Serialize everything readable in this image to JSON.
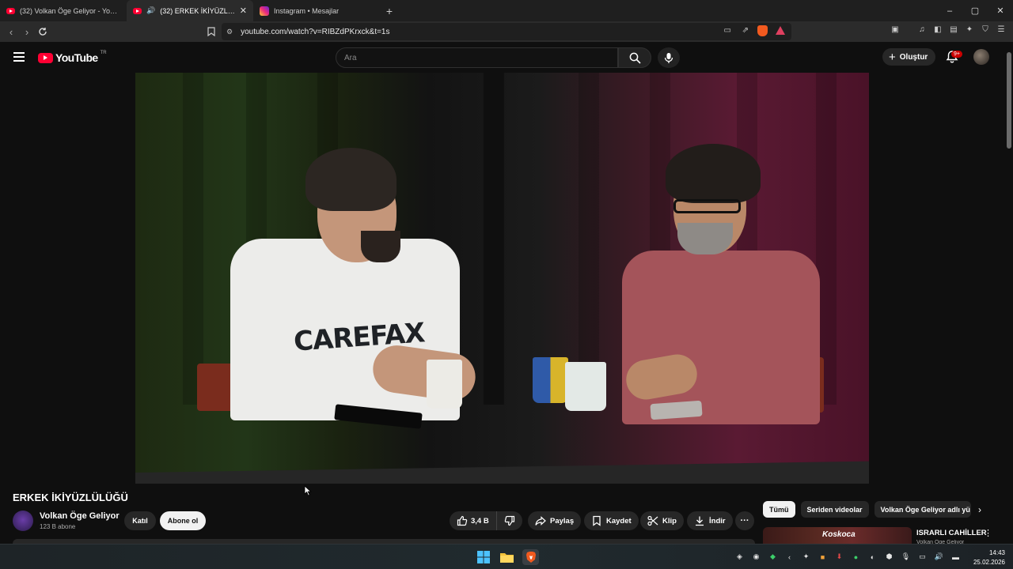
{
  "browser": {
    "tabs": [
      {
        "title": "(32) Volkan Öge Geliyor - YouTube",
        "active": false
      },
      {
        "title": "(32) ERKEK İKİYÜZLÜLÜĞÜ - Y",
        "active": true
      },
      {
        "title": "Instagram • Mesajlar",
        "active": false
      }
    ],
    "new_tab": "+",
    "window_controls": {
      "minimize": "–",
      "restore": "▢",
      "close": "✕"
    },
    "url": "youtube.com/watch?v=RIBZdPKrxck&t=1s"
  },
  "youtube": {
    "logo_text": "YouTube",
    "country_code": "TR",
    "search_placeholder": "Ara",
    "create_label": "Oluştur",
    "notification_badge": "9+"
  },
  "video": {
    "title": "ERKEK İKİYÜZLÜLÜĞÜ",
    "shirt_text": "CAREFAX",
    "channel_name": "Volkan Öge Geliyor",
    "subscribers": "123 B abone",
    "join_label": "Katıl",
    "subscribe_label": "Abone ol",
    "like_count": "3,4 B",
    "share_label": "Paylaş",
    "save_label": "Kaydet",
    "clip_label": "Klip",
    "download_label": "İndir",
    "more_label": "···"
  },
  "sidebar": {
    "chips": [
      "Tümü",
      "Seriden videolar",
      "Volkan Öge Geliyor adlı yü"
    ],
    "recommended": {
      "thumb_brand": "Koskoca",
      "title": "ISRARLI CAHİLLER",
      "channel": "Volkan Öge Geliyor"
    }
  },
  "taskbar": {
    "time": "14:43",
    "date": "25.02.2026"
  },
  "colors": {
    "accent_red": "#ff0033",
    "background": "#0f0f0f",
    "button_bg": "#272727"
  }
}
